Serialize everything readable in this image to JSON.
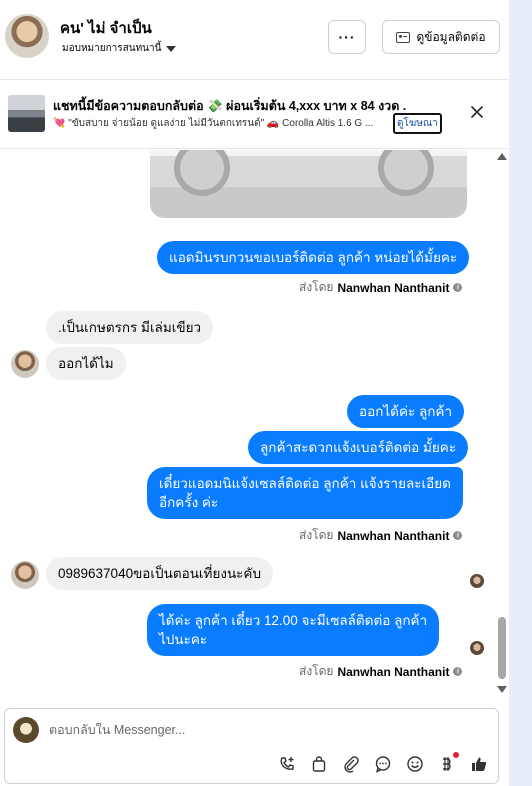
{
  "header": {
    "contact_name": "คน' ไม่ จำเป็น",
    "assign_label": "มอบหมายการสนทนานี้",
    "more_label": "···",
    "contact_info_label": "ดูข้อมูลติดต่อ"
  },
  "ad": {
    "title": "แชทนี้มีข้อความตอบกลับต่อ 💸 ผ่อนเริ่มต้น 4,xxx บาท x 84 งวด .",
    "subtitle": "💘 \"ขับสบาย จ่ายน้อย ดูแลง่าย ไม่มีวันตกเทรนด์\" 🚗 Corolla Altis 1.6 G ...",
    "link_label": "ดูโฆษณา"
  },
  "messages": [
    {
      "id": "m1",
      "from": "page",
      "text": "แอดมินรบกวนขอเบอร์ติดต่อ ลูกค้า หน่อยได้มั้ยคะ"
    },
    {
      "id": "m2",
      "from": "customer",
      "text": ".เป็นเกษตรกร มีเล่มเขียว"
    },
    {
      "id": "m3",
      "from": "customer",
      "text": "ออกได้ไม"
    },
    {
      "id": "m4",
      "from": "page",
      "text": "ออกได้ค่ะ  ลูกค้า"
    },
    {
      "id": "m5",
      "from": "page",
      "text": "ลูกค้าสะดวกแจ้งเบอร์ติดต่อ มั้ยคะ"
    },
    {
      "id": "m6",
      "from": "page",
      "lines": [
        "เดี๋ยวแอดมนิแจ้งเซลล์ติดต่อ ลูกค้า แจ้งรายละเอียด",
        "อีกครั้ง ค่ะ"
      ]
    },
    {
      "id": "m7",
      "from": "customer",
      "text": "0989637040ขอเป็นตอนเที่ยงนะคับ"
    },
    {
      "id": "m8",
      "from": "page",
      "lines": [
        "ได้ค่ะ  ลูกค้า  เดี๋ยว 12.00 จะมีเซลล์ติดต่อ ลูกค้า",
        "ไปนะคะ"
      ]
    }
  ],
  "sent_by": {
    "prefix": "ส่งโดย",
    "agent": "Nanwhan Nanthanit"
  },
  "composer": {
    "placeholder": "ตอบกลับใน Messenger..."
  },
  "icons": {
    "more": "more-dots-icon",
    "contact": "contact-card-icon",
    "close": "close-icon",
    "info": "info-icon",
    "toolbar": [
      "phone-add-icon",
      "bag-icon",
      "attachment-icon",
      "saved-reply-icon",
      "emoji-icon",
      "payment-icon",
      "thumbs-up-icon"
    ]
  },
  "colors": {
    "outgoing_bubble": "#0a7cff",
    "incoming_bubble": "#f0f0f0",
    "thumbs_up": "#0a7cff",
    "notification_dot": "#e41e3f"
  }
}
